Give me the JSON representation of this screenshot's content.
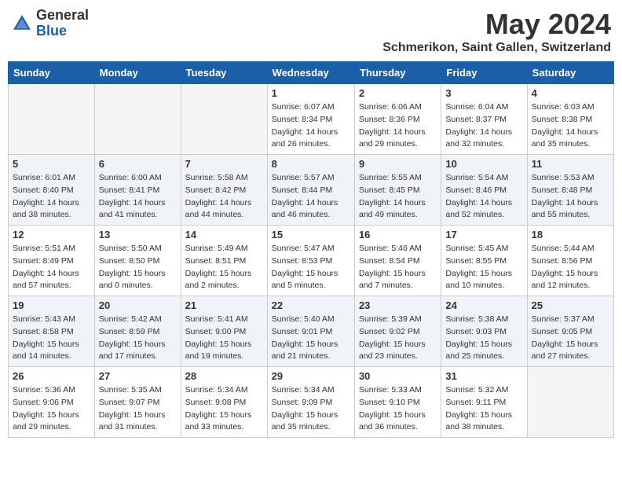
{
  "header": {
    "logo_general": "General",
    "logo_blue": "Blue",
    "month": "May 2024",
    "location": "Schmerikon, Saint Gallen, Switzerland"
  },
  "weekdays": [
    "Sunday",
    "Monday",
    "Tuesday",
    "Wednesday",
    "Thursday",
    "Friday",
    "Saturday"
  ],
  "weeks": [
    [
      {
        "day": "",
        "info": ""
      },
      {
        "day": "",
        "info": ""
      },
      {
        "day": "",
        "info": ""
      },
      {
        "day": "1",
        "info": "Sunrise: 6:07 AM\nSunset: 8:34 PM\nDaylight: 14 hours\nand 26 minutes."
      },
      {
        "day": "2",
        "info": "Sunrise: 6:06 AM\nSunset: 8:36 PM\nDaylight: 14 hours\nand 29 minutes."
      },
      {
        "day": "3",
        "info": "Sunrise: 6:04 AM\nSunset: 8:37 PM\nDaylight: 14 hours\nand 32 minutes."
      },
      {
        "day": "4",
        "info": "Sunrise: 6:03 AM\nSunset: 8:38 PM\nDaylight: 14 hours\nand 35 minutes."
      }
    ],
    [
      {
        "day": "5",
        "info": "Sunrise: 6:01 AM\nSunset: 8:40 PM\nDaylight: 14 hours\nand 38 minutes."
      },
      {
        "day": "6",
        "info": "Sunrise: 6:00 AM\nSunset: 8:41 PM\nDaylight: 14 hours\nand 41 minutes."
      },
      {
        "day": "7",
        "info": "Sunrise: 5:58 AM\nSunset: 8:42 PM\nDaylight: 14 hours\nand 44 minutes."
      },
      {
        "day": "8",
        "info": "Sunrise: 5:57 AM\nSunset: 8:44 PM\nDaylight: 14 hours\nand 46 minutes."
      },
      {
        "day": "9",
        "info": "Sunrise: 5:55 AM\nSunset: 8:45 PM\nDaylight: 14 hours\nand 49 minutes."
      },
      {
        "day": "10",
        "info": "Sunrise: 5:54 AM\nSunset: 8:46 PM\nDaylight: 14 hours\nand 52 minutes."
      },
      {
        "day": "11",
        "info": "Sunrise: 5:53 AM\nSunset: 8:48 PM\nDaylight: 14 hours\nand 55 minutes."
      }
    ],
    [
      {
        "day": "12",
        "info": "Sunrise: 5:51 AM\nSunset: 8:49 PM\nDaylight: 14 hours\nand 57 minutes."
      },
      {
        "day": "13",
        "info": "Sunrise: 5:50 AM\nSunset: 8:50 PM\nDaylight: 15 hours\nand 0 minutes."
      },
      {
        "day": "14",
        "info": "Sunrise: 5:49 AM\nSunset: 8:51 PM\nDaylight: 15 hours\nand 2 minutes."
      },
      {
        "day": "15",
        "info": "Sunrise: 5:47 AM\nSunset: 8:53 PM\nDaylight: 15 hours\nand 5 minutes."
      },
      {
        "day": "16",
        "info": "Sunrise: 5:46 AM\nSunset: 8:54 PM\nDaylight: 15 hours\nand 7 minutes."
      },
      {
        "day": "17",
        "info": "Sunrise: 5:45 AM\nSunset: 8:55 PM\nDaylight: 15 hours\nand 10 minutes."
      },
      {
        "day": "18",
        "info": "Sunrise: 5:44 AM\nSunset: 8:56 PM\nDaylight: 15 hours\nand 12 minutes."
      }
    ],
    [
      {
        "day": "19",
        "info": "Sunrise: 5:43 AM\nSunset: 8:58 PM\nDaylight: 15 hours\nand 14 minutes."
      },
      {
        "day": "20",
        "info": "Sunrise: 5:42 AM\nSunset: 8:59 PM\nDaylight: 15 hours\nand 17 minutes."
      },
      {
        "day": "21",
        "info": "Sunrise: 5:41 AM\nSunset: 9:00 PM\nDaylight: 15 hours\nand 19 minutes."
      },
      {
        "day": "22",
        "info": "Sunrise: 5:40 AM\nSunset: 9:01 PM\nDaylight: 15 hours\nand 21 minutes."
      },
      {
        "day": "23",
        "info": "Sunrise: 5:39 AM\nSunset: 9:02 PM\nDaylight: 15 hours\nand 23 minutes."
      },
      {
        "day": "24",
        "info": "Sunrise: 5:38 AM\nSunset: 9:03 PM\nDaylight: 15 hours\nand 25 minutes."
      },
      {
        "day": "25",
        "info": "Sunrise: 5:37 AM\nSunset: 9:05 PM\nDaylight: 15 hours\nand 27 minutes."
      }
    ],
    [
      {
        "day": "26",
        "info": "Sunrise: 5:36 AM\nSunset: 9:06 PM\nDaylight: 15 hours\nand 29 minutes."
      },
      {
        "day": "27",
        "info": "Sunrise: 5:35 AM\nSunset: 9:07 PM\nDaylight: 15 hours\nand 31 minutes."
      },
      {
        "day": "28",
        "info": "Sunrise: 5:34 AM\nSunset: 9:08 PM\nDaylight: 15 hours\nand 33 minutes."
      },
      {
        "day": "29",
        "info": "Sunrise: 5:34 AM\nSunset: 9:09 PM\nDaylight: 15 hours\nand 35 minutes."
      },
      {
        "day": "30",
        "info": "Sunrise: 5:33 AM\nSunset: 9:10 PM\nDaylight: 15 hours\nand 36 minutes."
      },
      {
        "day": "31",
        "info": "Sunrise: 5:32 AM\nSunset: 9:11 PM\nDaylight: 15 hours\nand 38 minutes."
      },
      {
        "day": "",
        "info": ""
      }
    ]
  ]
}
